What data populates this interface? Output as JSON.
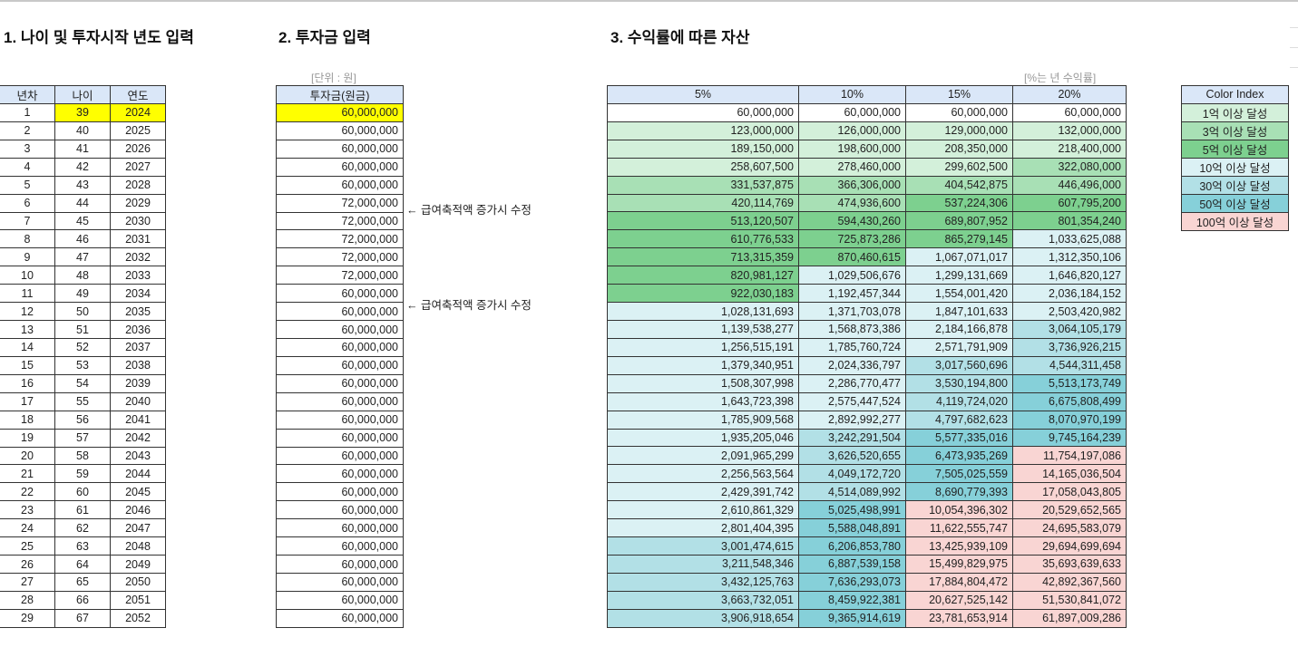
{
  "sections": {
    "s1": "1. 나이 및 투자시작 년도 입력",
    "s2": "2. 투자금 입력",
    "s3": "3. 수익률에 따른 자산"
  },
  "notes": {
    "unit": "[단위 : 원]",
    "rate": "[%는 년 수익률]"
  },
  "memo": "← 급여축적액 증가시 수정",
  "age_table": {
    "headers": [
      "년차",
      "나이",
      "연도"
    ],
    "rows": [
      [
        "1",
        "39",
        "2024"
      ],
      [
        "2",
        "40",
        "2025"
      ],
      [
        "3",
        "41",
        "2026"
      ],
      [
        "4",
        "42",
        "2027"
      ],
      [
        "5",
        "43",
        "2028"
      ],
      [
        "6",
        "44",
        "2029"
      ],
      [
        "7",
        "45",
        "2030"
      ],
      [
        "8",
        "46",
        "2031"
      ],
      [
        "9",
        "47",
        "2032"
      ],
      [
        "10",
        "48",
        "2033"
      ],
      [
        "11",
        "49",
        "2034"
      ],
      [
        "12",
        "50",
        "2035"
      ],
      [
        "13",
        "51",
        "2036"
      ],
      [
        "14",
        "52",
        "2037"
      ],
      [
        "15",
        "53",
        "2038"
      ],
      [
        "16",
        "54",
        "2039"
      ],
      [
        "17",
        "55",
        "2040"
      ],
      [
        "18",
        "56",
        "2041"
      ],
      [
        "19",
        "57",
        "2042"
      ],
      [
        "20",
        "58",
        "2043"
      ],
      [
        "21",
        "59",
        "2044"
      ],
      [
        "22",
        "60",
        "2045"
      ],
      [
        "23",
        "61",
        "2046"
      ],
      [
        "24",
        "62",
        "2047"
      ],
      [
        "25",
        "63",
        "2048"
      ],
      [
        "26",
        "64",
        "2049"
      ],
      [
        "27",
        "65",
        "2050"
      ],
      [
        "28",
        "66",
        "2051"
      ],
      [
        "29",
        "67",
        "2052"
      ]
    ]
  },
  "invest_table": {
    "header": "투자금(원금)",
    "rows": [
      "60,000,000",
      "60,000,000",
      "60,000,000",
      "60,000,000",
      "60,000,000",
      "72,000,000",
      "72,000,000",
      "72,000,000",
      "72,000,000",
      "72,000,000",
      "60,000,000",
      "60,000,000",
      "60,000,000",
      "60,000,000",
      "60,000,000",
      "60,000,000",
      "60,000,000",
      "60,000,000",
      "60,000,000",
      "60,000,000",
      "60,000,000",
      "60,000,000",
      "60,000,000",
      "60,000,000",
      "60,000,000",
      "60,000,000",
      "60,000,000",
      "60,000,000",
      "60,000,000"
    ]
  },
  "asset_table": {
    "headers": [
      "5%",
      "10%",
      "15%",
      "20%"
    ],
    "rows": [
      [
        "60,000,000",
        "60,000,000",
        "60,000,000",
        "60,000,000"
      ],
      [
        "123,000,000",
        "126,000,000",
        "129,000,000",
        "132,000,000"
      ],
      [
        "189,150,000",
        "198,600,000",
        "208,350,000",
        "218,400,000"
      ],
      [
        "258,607,500",
        "278,460,000",
        "299,602,500",
        "322,080,000"
      ],
      [
        "331,537,875",
        "366,306,000",
        "404,542,875",
        "446,496,000"
      ],
      [
        "420,114,769",
        "474,936,600",
        "537,224,306",
        "607,795,200"
      ],
      [
        "513,120,507",
        "594,430,260",
        "689,807,952",
        "801,354,240"
      ],
      [
        "610,776,533",
        "725,873,286",
        "865,279,145",
        "1,033,625,088"
      ],
      [
        "713,315,359",
        "870,460,615",
        "1,067,071,017",
        "1,312,350,106"
      ],
      [
        "820,981,127",
        "1,029,506,676",
        "1,299,131,669",
        "1,646,820,127"
      ],
      [
        "922,030,183",
        "1,192,457,344",
        "1,554,001,420",
        "2,036,184,152"
      ],
      [
        "1,028,131,693",
        "1,371,703,078",
        "1,847,101,633",
        "2,503,420,982"
      ],
      [
        "1,139,538,277",
        "1,568,873,386",
        "2,184,166,878",
        "3,064,105,179"
      ],
      [
        "1,256,515,191",
        "1,785,760,724",
        "2,571,791,909",
        "3,736,926,215"
      ],
      [
        "1,379,340,951",
        "2,024,336,797",
        "3,017,560,696",
        "4,544,311,458"
      ],
      [
        "1,508,307,998",
        "2,286,770,477",
        "3,530,194,800",
        "5,513,173,749"
      ],
      [
        "1,643,723,398",
        "2,575,447,524",
        "4,119,724,020",
        "6,675,808,499"
      ],
      [
        "1,785,909,568",
        "2,892,992,277",
        "4,797,682,623",
        "8,070,970,199"
      ],
      [
        "1,935,205,046",
        "3,242,291,504",
        "5,577,335,016",
        "9,745,164,239"
      ],
      [
        "2,091,965,299",
        "3,626,520,655",
        "6,473,935,269",
        "11,754,197,086"
      ],
      [
        "2,256,563,564",
        "4,049,172,720",
        "7,505,025,559",
        "14,165,036,504"
      ],
      [
        "2,429,391,742",
        "4,514,089,992",
        "8,690,779,393",
        "17,058,043,805"
      ],
      [
        "2,610,861,329",
        "5,025,498,991",
        "10,054,396,302",
        "20,529,652,565"
      ],
      [
        "2,801,404,395",
        "5,588,048,891",
        "11,622,555,747",
        "24,695,583,079"
      ],
      [
        "3,001,474,615",
        "6,206,853,780",
        "13,425,939,109",
        "29,694,699,694"
      ],
      [
        "3,211,548,346",
        "6,887,539,158",
        "15,499,829,975",
        "35,693,639,633"
      ],
      [
        "3,432,125,763",
        "7,636,293,073",
        "17,884,804,472",
        "42,892,367,560"
      ],
      [
        "3,663,732,051",
        "8,459,922,381",
        "20,627,525,142",
        "51,530,841,072"
      ],
      [
        "3,906,918,654",
        "9,365,914,619",
        "23,781,653,914",
        "61,897,009,286"
      ]
    ]
  },
  "color_index": {
    "header": "Color Index",
    "items": [
      {
        "label": "1억 이상 달성",
        "color": "#d3f0da",
        "min": 100000000
      },
      {
        "label": "3억 이상 달성",
        "color": "#a8e0b5",
        "min": 300000000
      },
      {
        "label": "5억 이상 달성",
        "color": "#7dd08f",
        "min": 500000000
      },
      {
        "label": "10억 이상 달성",
        "color": "#dbf1f4",
        "min": 1000000000
      },
      {
        "label": "30억 이상 달성",
        "color": "#b2e0e6",
        "min": 3000000000
      },
      {
        "label": "50억 이상 달성",
        "color": "#86d0d9",
        "min": 5000000000
      },
      {
        "label": "100억 이상 달성",
        "color": "#f9d5d3",
        "min": 10000000000
      }
    ]
  },
  "colors": {
    "header_bg": "#dae7f8",
    "input_yellow": "#ffff00"
  }
}
